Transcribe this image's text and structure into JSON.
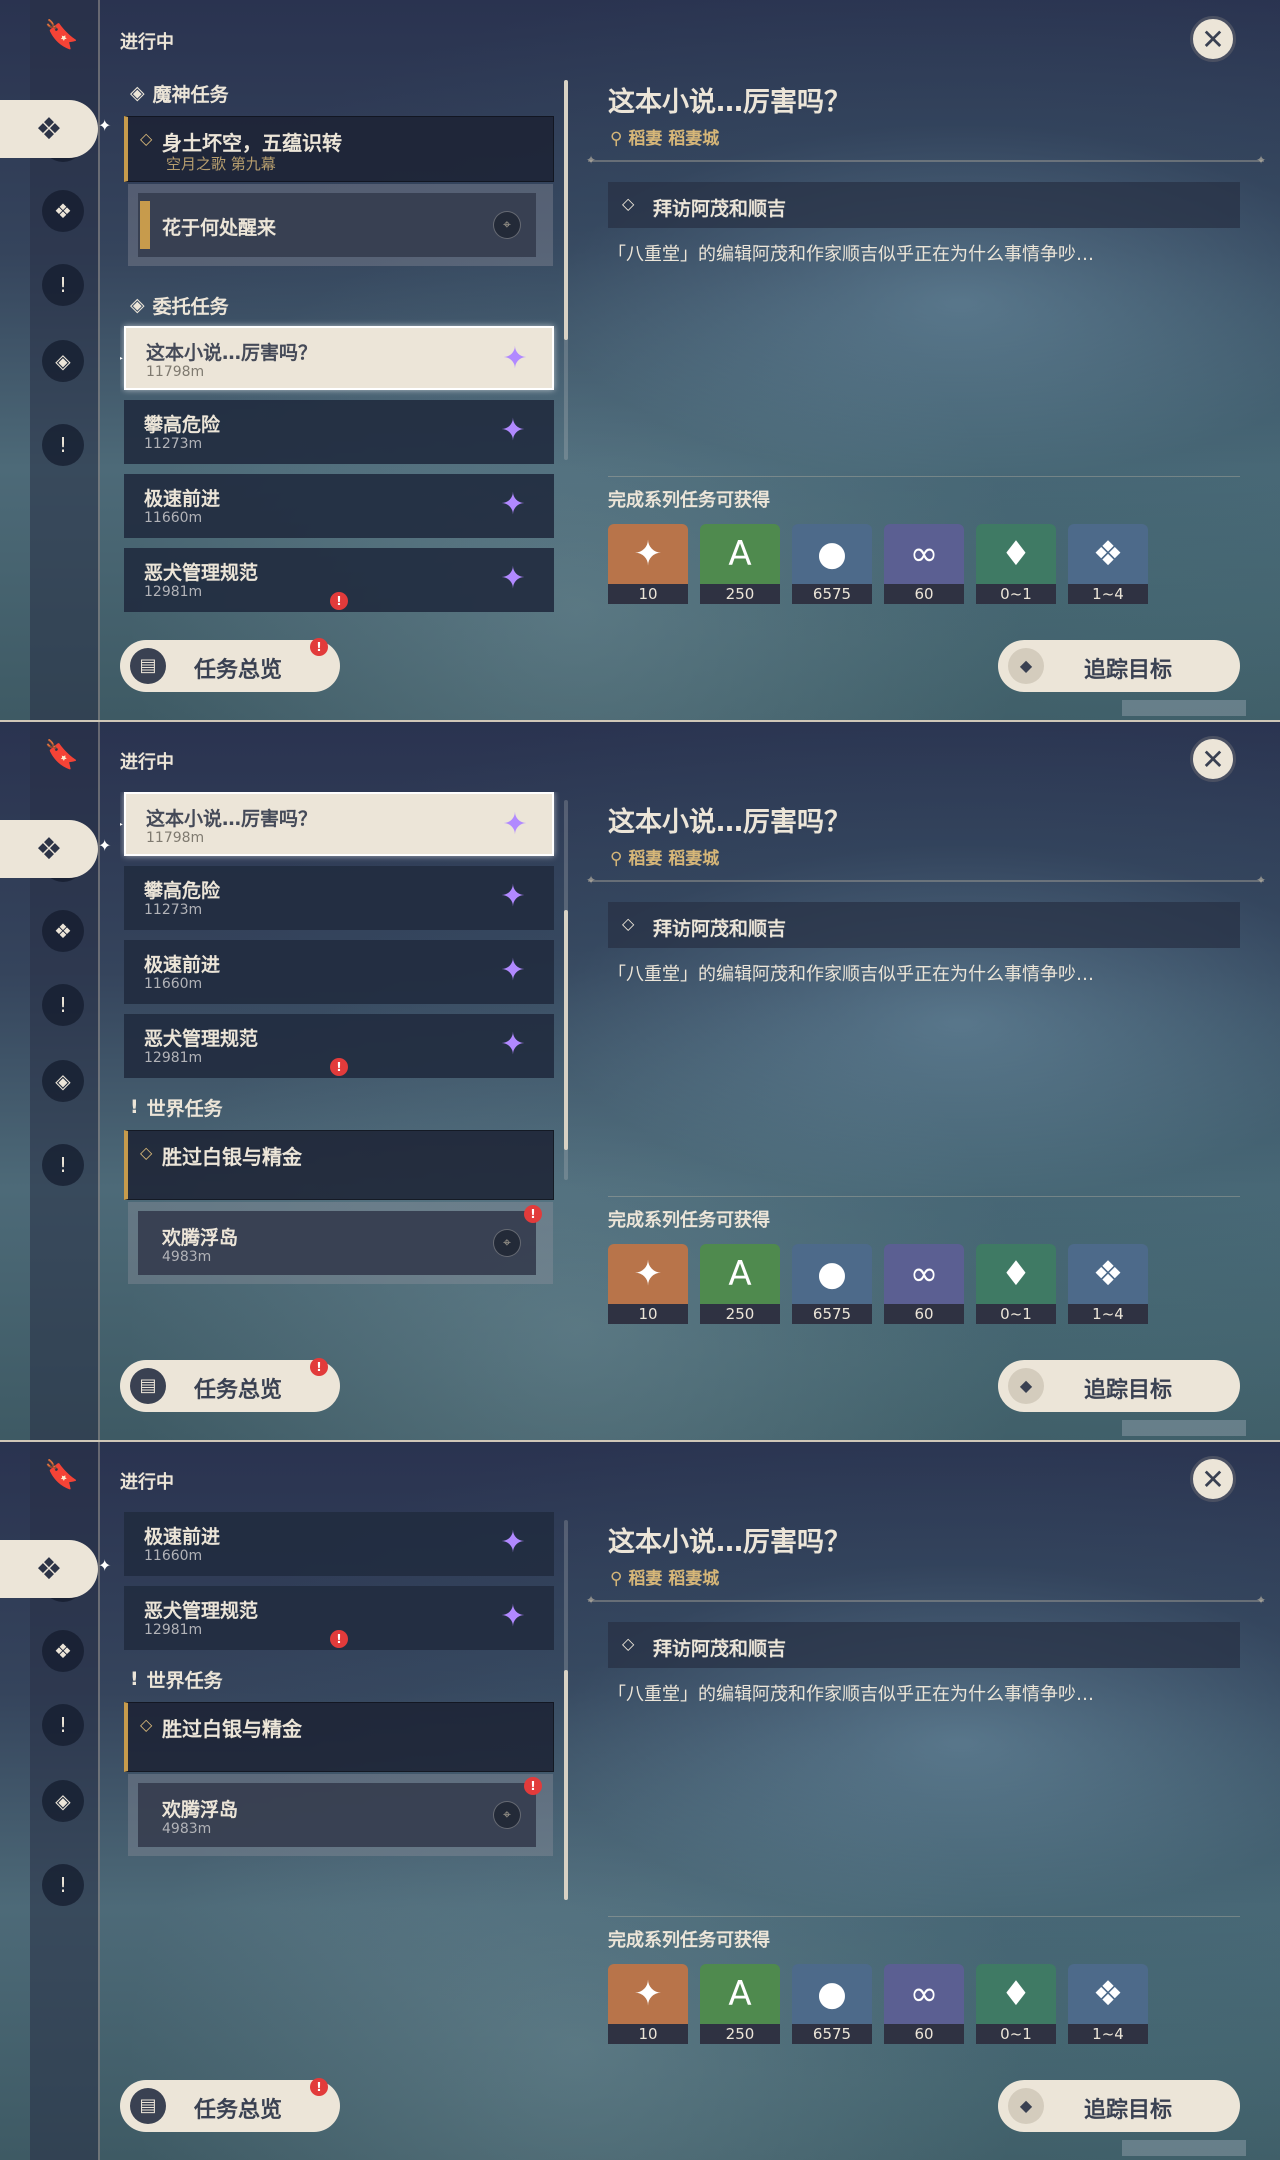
{
  "status_label": "进行中",
  "close_icon": "close-icon",
  "sections": {
    "archon": "魔神任务",
    "commission": "委托任务",
    "world": "世界任务"
  },
  "archon_quest": {
    "title": "身土坏空，五蕴识转",
    "subtitle": "空月之歌 第九幕",
    "sub_step": "花于何处醒来"
  },
  "commissions": [
    {
      "title": "这本小说…厉害吗？",
      "dist": "11798m"
    },
    {
      "title": "攀高危险",
      "dist": "11273m"
    },
    {
      "title": "极速前进",
      "dist": "11660m"
    },
    {
      "title": "恶犬管理规范",
      "dist": "12981m"
    }
  ],
  "world_quest": {
    "title": "胜过白银与精金",
    "sub_step": "欢腾浮岛",
    "sub_dist": "4983m"
  },
  "alert_mark": "!",
  "buttons": {
    "overview": "任务总览",
    "track": "追踪目标"
  },
  "detail": {
    "title": "这本小说…厉害吗？",
    "location": "稻妻 稻妻城",
    "step": "拜访阿茂和顺吉",
    "description": "「八重堂」的编辑阿茂和作家顺吉似乎正在为什么事情争吵…",
    "reward_label": "完成系列任务可获得",
    "rewards": [
      {
        "name": "primogem",
        "qty": "10",
        "color": "#b8744a"
      },
      {
        "name": "adventure-exp",
        "qty": "250",
        "color": "#4f8a4e"
      },
      {
        "name": "mora",
        "qty": "6575",
        "color": "#4d6a8a"
      },
      {
        "name": "friendship-exp",
        "qty": "60",
        "color": "#5b5f92"
      },
      {
        "name": "crystal",
        "qty": "0~1",
        "color": "#3f7a64"
      },
      {
        "name": "crystal-cluster",
        "qty": "1~4",
        "color": "#4d6a8a"
      }
    ]
  }
}
